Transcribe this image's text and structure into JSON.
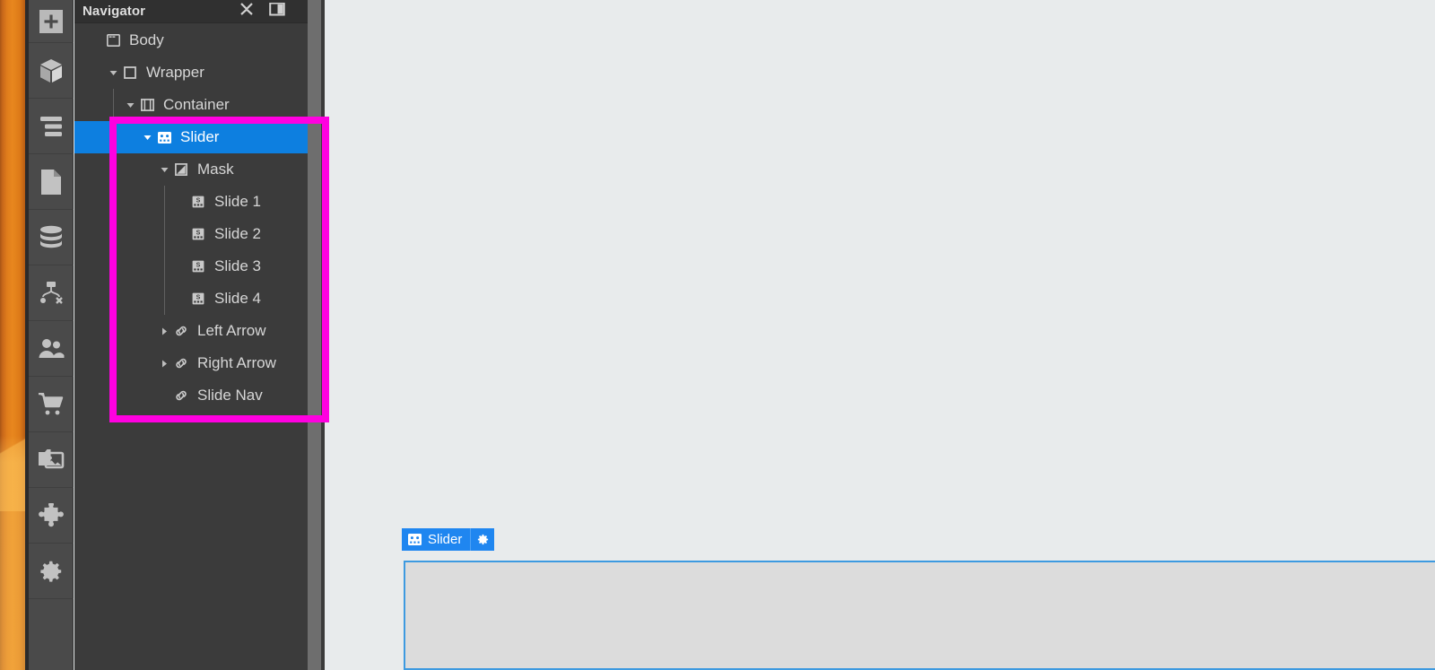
{
  "app": {
    "accent_blue": "#0d7fe0",
    "highlight_magenta": "#ff00e0",
    "panel_bg": "#3b3b3b",
    "canvas_bg": "#e8ebec"
  },
  "toolbar": {
    "items": [
      {
        "name": "add-element-button",
        "icon": "plus-icon",
        "title": "Add Element"
      },
      {
        "name": "components-button",
        "icon": "cube-icon",
        "title": "Components"
      },
      {
        "name": "navigator-button",
        "icon": "layers-list-icon",
        "title": "Navigator"
      },
      {
        "name": "pages-button",
        "icon": "page-icon",
        "title": "Pages"
      },
      {
        "name": "cms-button",
        "icon": "database-icon",
        "title": "CMS Collections"
      },
      {
        "name": "logic-button",
        "icon": "logic-flow-icon",
        "title": "Logic"
      },
      {
        "name": "users-button",
        "icon": "users-icon",
        "title": "Users"
      },
      {
        "name": "ecommerce-button",
        "icon": "shopping-cart-icon",
        "title": "Ecommerce"
      },
      {
        "name": "assets-button",
        "icon": "images-icon",
        "title": "Assets"
      },
      {
        "name": "apps-button",
        "icon": "puzzle-icon",
        "title": "Apps"
      },
      {
        "name": "settings-button",
        "icon": "gear-icon",
        "title": "Settings"
      }
    ]
  },
  "navigator": {
    "title": "Navigator",
    "header_actions": [
      {
        "name": "collapse-all-icon",
        "icon": "collapse-all-icon"
      },
      {
        "name": "panel-toggle-icon",
        "icon": "panel-toggle-icon"
      }
    ],
    "tree": [
      {
        "label": "Body",
        "icon": "body-icon",
        "depth": 0,
        "twisty": "none",
        "selected": false
      },
      {
        "label": "Wrapper",
        "icon": "div-block-icon",
        "depth": 1,
        "twisty": "expanded",
        "selected": false
      },
      {
        "label": "Container",
        "icon": "container-icon",
        "depth": 2,
        "twisty": "expanded",
        "selected": false
      },
      {
        "label": "Slider",
        "icon": "slider-icon",
        "depth": 3,
        "twisty": "expanded",
        "selected": true
      },
      {
        "label": "Mask",
        "icon": "mask-icon",
        "depth": 4,
        "twisty": "expanded",
        "selected": false
      },
      {
        "label": "Slide 1",
        "icon": "slide-icon",
        "depth": 5,
        "twisty": "none",
        "selected": false
      },
      {
        "label": "Slide 2",
        "icon": "slide-icon",
        "depth": 5,
        "twisty": "none",
        "selected": false
      },
      {
        "label": "Slide 3",
        "icon": "slide-icon",
        "depth": 5,
        "twisty": "none",
        "selected": false
      },
      {
        "label": "Slide 4",
        "icon": "slide-icon",
        "depth": 5,
        "twisty": "none",
        "selected": false
      },
      {
        "label": "Left Arrow",
        "icon": "link-icon",
        "depth": 4,
        "twisty": "collapsed",
        "selected": false
      },
      {
        "label": "Right Arrow",
        "icon": "link-icon",
        "depth": 4,
        "twisty": "collapsed",
        "selected": false
      },
      {
        "label": "Slide Nav",
        "icon": "link-icon",
        "depth": 4,
        "twisty": "none",
        "selected": false
      }
    ]
  },
  "canvas": {
    "selected_element": {
      "label": "Slider",
      "icon": "slider-icon",
      "settings_icon": "gear-icon"
    }
  }
}
